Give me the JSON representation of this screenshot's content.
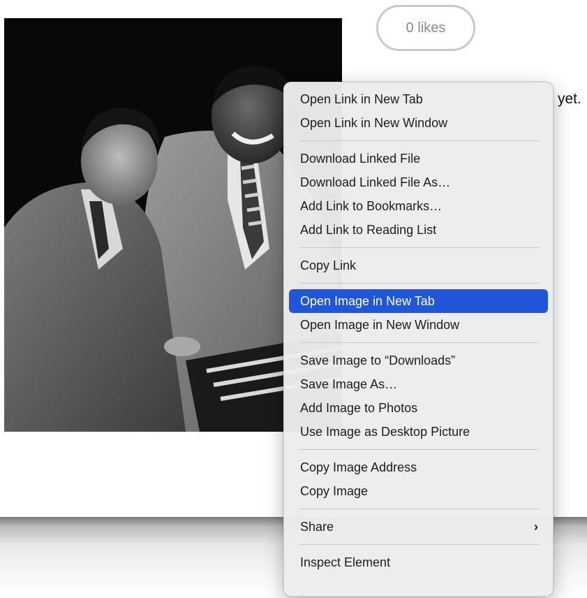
{
  "likes": {
    "label": "0 likes"
  },
  "side_text": "yet.",
  "menu": {
    "items": [
      {
        "label": "Open Link in New Tab"
      },
      {
        "label": "Open Link in New Window"
      },
      {
        "label": "Download Linked File"
      },
      {
        "label": "Download Linked File As…"
      },
      {
        "label": "Add Link to Bookmarks…"
      },
      {
        "label": "Add Link to Reading List"
      },
      {
        "label": "Copy Link"
      },
      {
        "label": "Open Image in New Tab",
        "highlighted": true
      },
      {
        "label": "Open Image in New Window"
      },
      {
        "label": "Save Image to “Downloads”"
      },
      {
        "label": "Save Image As…"
      },
      {
        "label": "Add Image to Photos"
      },
      {
        "label": "Use Image as Desktop Picture"
      },
      {
        "label": "Copy Image Address"
      },
      {
        "label": "Copy Image"
      },
      {
        "label": "Share",
        "submenu_icon": "chevron-right-icon"
      },
      {
        "label": "Inspect Element"
      }
    ]
  },
  "colors": {
    "highlight": "#2156d8",
    "menu_background": "#ececec",
    "likes_border": "#c9c9c9"
  }
}
